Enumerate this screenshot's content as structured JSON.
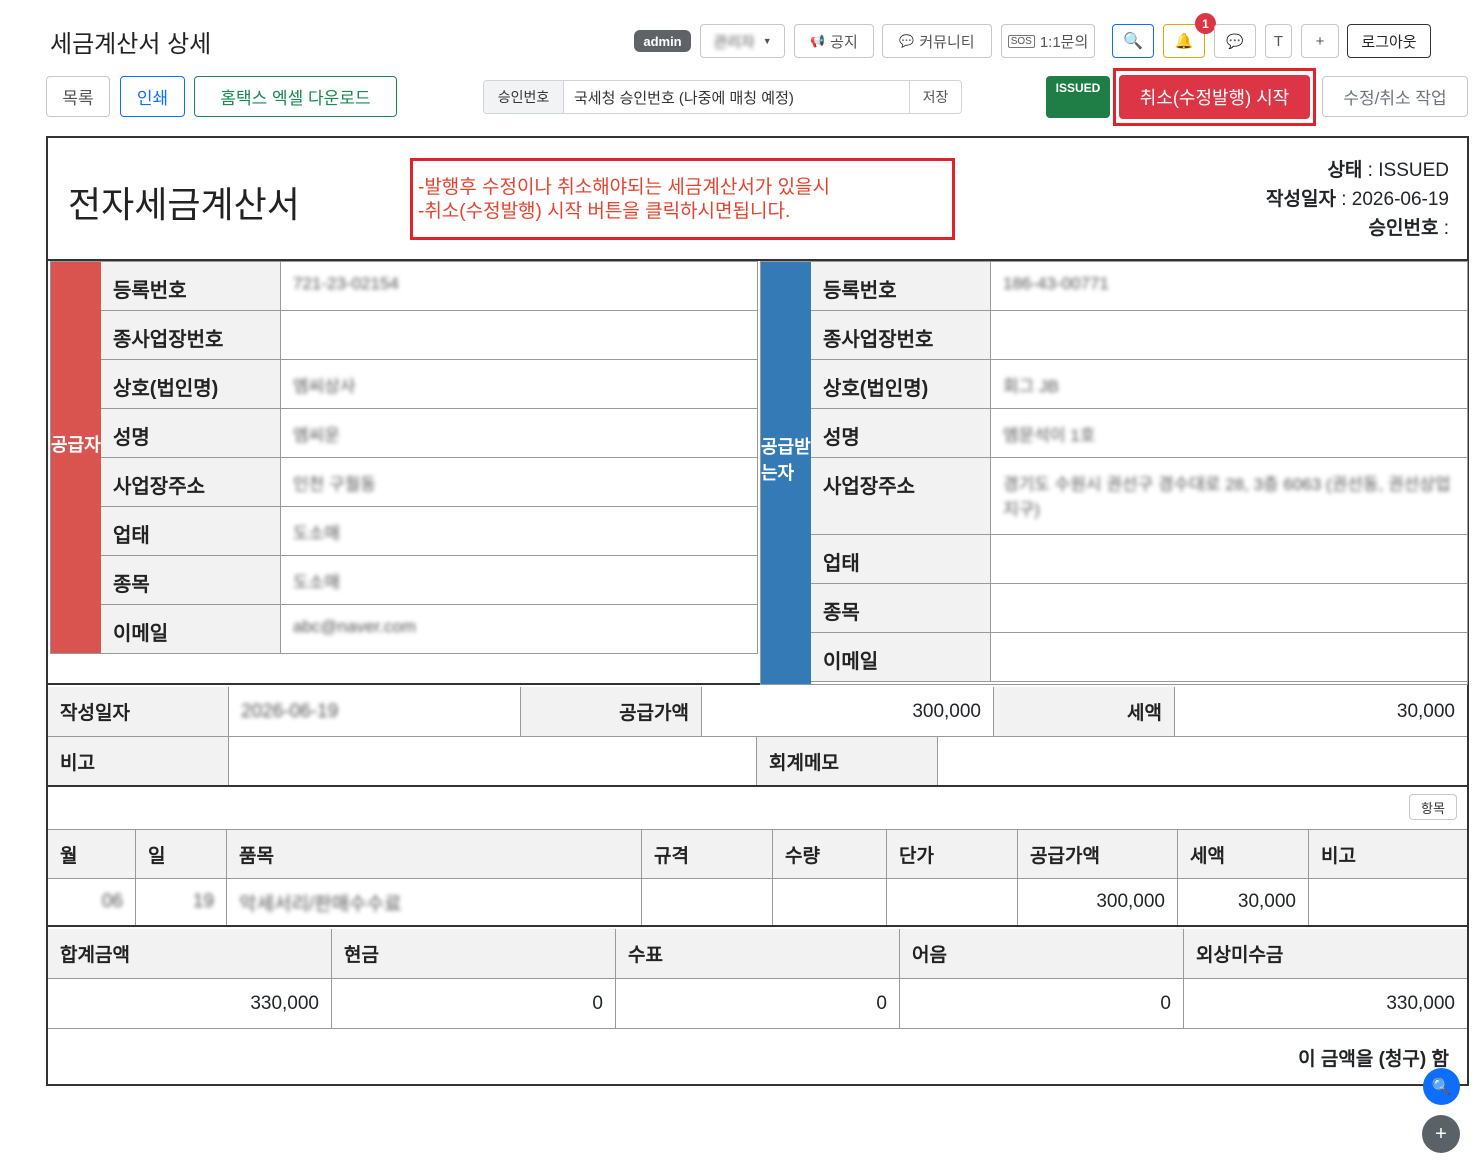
{
  "header": {
    "title": "세금계산서 상세",
    "admin_badge": "admin",
    "user_dropdown": "관리자",
    "notice": "공지",
    "community": "커뮤니티",
    "inquiry": "1:1문의",
    "notification_count": "1",
    "t_btn": "T",
    "plus_btn": "+",
    "logout": "로그아웃"
  },
  "toolbar": {
    "list": "목록",
    "print": "인쇄",
    "hometax_excel": "홈택스 엑셀 다운로드",
    "approval_label": "승인번호",
    "approval_value": "국세청 승인번호 (나중에 매칭 예정)",
    "save": "저장",
    "status_badge": "ISSUED",
    "cancel_start": "취소(수정발행) 시작",
    "edit_cancel_work": "수정/취소 작업"
  },
  "document": {
    "title": "전자세금계산서",
    "notice_lines": [
      "-발행후 수정이나 취소해야되는 세금계산서가 있을시",
      "-취소(수정발행) 시작 버튼을 클릭하시면됩니다."
    ],
    "status_label": "상태",
    "status_value": "ISSUED",
    "date_label": "작성일자",
    "date_value": "2026-06-19",
    "approval_label": "승인번호",
    "approval_value": ""
  },
  "supplier": {
    "side_label": "공급자",
    "rows": [
      {
        "k": "등록번호",
        "v": "721-23-02154"
      },
      {
        "k": "종사업장번호",
        "v": ""
      },
      {
        "k": "상호(법인명)",
        "v": "엠씨상사"
      },
      {
        "k": "성명",
        "v": "엠씨운"
      },
      {
        "k": "사업장주소",
        "v": "인천 구월동"
      },
      {
        "k": "업태",
        "v": "도소매"
      },
      {
        "k": "종목",
        "v": "도소매"
      },
      {
        "k": "이메일",
        "v": "abc@naver.com"
      }
    ]
  },
  "receiver": {
    "side_label": "공급받는자",
    "rows": [
      {
        "k": "등록번호",
        "v": "186-43-00771"
      },
      {
        "k": "종사업장번호",
        "v": ""
      },
      {
        "k": "상호(법인명)",
        "v": "회그 JB"
      },
      {
        "k": "성명",
        "v": "엠문석이 1호"
      },
      {
        "k": "사업장주소",
        "v": "경기도 수원시 권선구 경수대로 28, 3층 6063 (권선동, 권선상업지구)"
      },
      {
        "k": "업태",
        "v": ""
      },
      {
        "k": "종목",
        "v": ""
      },
      {
        "k": "이메일",
        "v": ""
      }
    ]
  },
  "summary": {
    "date_label": "작성일자",
    "date_value": "2026-06-19",
    "supply_label": "공급가액",
    "supply_value": "300,000",
    "tax_label": "세액",
    "tax_value": "30,000",
    "remark_label": "비고",
    "remark_value": "",
    "memo_label": "회계메모",
    "memo_value": ""
  },
  "items": {
    "add_button": "항목",
    "headers": [
      "월",
      "일",
      "품목",
      "규격",
      "수량",
      "단가",
      "공급가액",
      "세액",
      "비고"
    ],
    "rows": [
      {
        "month": "06",
        "day": "19",
        "name": "악세서리/판매수수료",
        "spec": "",
        "qty": "",
        "price": "",
        "supply": "300,000",
        "tax": "30,000",
        "remark": ""
      }
    ]
  },
  "totals": {
    "headers": [
      "합계금액",
      "현금",
      "수표",
      "어음",
      "외상미수금"
    ],
    "values": [
      "330,000",
      "0",
      "0",
      "0",
      "330,000"
    ],
    "footer": "이 금액을 (청구) 함"
  },
  "colors": {
    "supplier": "#d9534f",
    "receiver": "#337ab7",
    "danger": "#dc3545",
    "success": "#1e7e45"
  }
}
